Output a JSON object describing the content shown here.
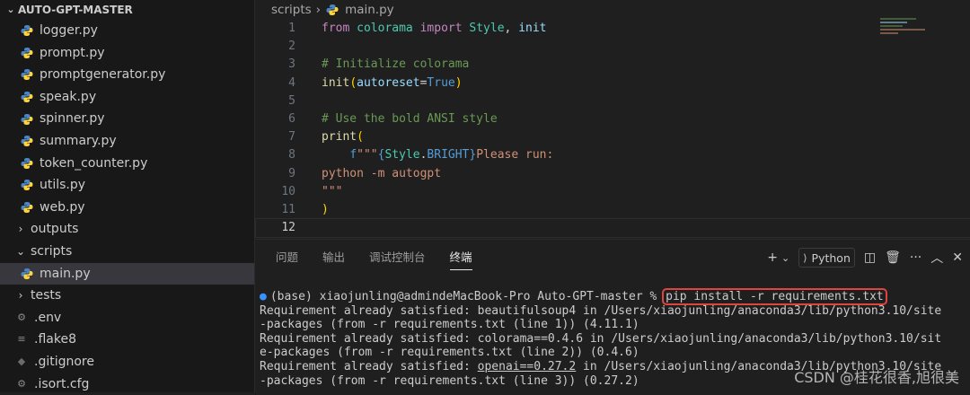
{
  "explorer": {
    "root_label": "AUTO-GPT-MASTER",
    "items": [
      {
        "label": "logger.py",
        "type": "py",
        "indent": 2
      },
      {
        "label": "prompt.py",
        "type": "py",
        "indent": 2
      },
      {
        "label": "promptgenerator.py",
        "type": "py",
        "indent": 2
      },
      {
        "label": "speak.py",
        "type": "py",
        "indent": 2
      },
      {
        "label": "spinner.py",
        "type": "py",
        "indent": 2
      },
      {
        "label": "summary.py",
        "type": "py",
        "indent": 2
      },
      {
        "label": "token_counter.py",
        "type": "py",
        "indent": 2
      },
      {
        "label": "utils.py",
        "type": "py",
        "indent": 2
      },
      {
        "label": "web.py",
        "type": "py",
        "indent": 2
      },
      {
        "label": "outputs",
        "type": "folder-closed",
        "indent": 1
      },
      {
        "label": "scripts",
        "type": "folder-open",
        "indent": 1
      },
      {
        "label": "main.py",
        "type": "py",
        "indent": 2,
        "selected": true
      },
      {
        "label": "tests",
        "type": "folder-closed",
        "indent": 1
      },
      {
        "label": ".env",
        "type": "gear",
        "indent": 1
      },
      {
        "label": ".flake8",
        "type": "lines",
        "indent": 1
      },
      {
        "label": ".gitignore",
        "type": "git",
        "indent": 1
      },
      {
        "label": ".isort.cfg",
        "type": "gear",
        "indent": 1
      }
    ]
  },
  "editor": {
    "breadcrumb": [
      "scripts",
      "main.py"
    ],
    "current_line": 12,
    "lines": [
      {
        "n": "1",
        "tokens": [
          [
            "kw",
            "from "
          ],
          [
            "mod",
            "colorama "
          ],
          [
            "kw",
            "import "
          ],
          [
            "mod",
            "Style"
          ],
          [
            "ltext",
            ", "
          ],
          [
            "id",
            "init"
          ]
        ]
      },
      {
        "n": "2",
        "tokens": []
      },
      {
        "n": "3",
        "tokens": [
          [
            "cm",
            "# Initialize colorama"
          ]
        ]
      },
      {
        "n": "4",
        "tokens": [
          [
            "fn",
            "init"
          ],
          [
            "br",
            "("
          ],
          [
            "id",
            "autoreset"
          ],
          [
            "ltext",
            "="
          ],
          [
            "cst",
            "True"
          ],
          [
            "br",
            ")"
          ]
        ]
      },
      {
        "n": "5",
        "tokens": []
      },
      {
        "n": "6",
        "tokens": [
          [
            "cm",
            "# Use the bold ANSI style"
          ]
        ]
      },
      {
        "n": "7",
        "tokens": [
          [
            "fn",
            "print"
          ],
          [
            "br",
            "("
          ]
        ]
      },
      {
        "n": "8",
        "tokens": [
          [
            "ltext",
            "    "
          ],
          [
            "cst",
            "f"
          ],
          [
            "str",
            "\"\"\""
          ],
          [
            "brace",
            "{"
          ],
          [
            "mod",
            "Style"
          ],
          [
            "ltext",
            "."
          ],
          [
            "cst",
            "BRIGHT"
          ],
          [
            "brace",
            "}"
          ],
          [
            "str",
            "Please run:"
          ]
        ]
      },
      {
        "n": "9",
        "tokens": [
          [
            "str",
            "python -m autogpt"
          ]
        ]
      },
      {
        "n": "10",
        "tokens": [
          [
            "str",
            "\"\"\""
          ]
        ]
      },
      {
        "n": "11",
        "tokens": [
          [
            "br",
            ")"
          ]
        ]
      },
      {
        "n": "12",
        "tokens": []
      }
    ]
  },
  "panel": {
    "tabs": [
      {
        "label": "问题",
        "active": false
      },
      {
        "label": "输出",
        "active": false
      },
      {
        "label": "调试控制台",
        "active": false
      },
      {
        "label": "终端",
        "active": true
      }
    ],
    "terminal_type": "Python",
    "prompt": "(base) xiaojunling@admindeMacBook-Pro Auto-GPT-master % ",
    "command": "pip install -r requirements.txt",
    "output": [
      "Requirement already satisfied: beautifulsoup4 in /Users/xiaojunling/anaconda3/lib/python3.10/site",
      "-packages (from -r requirements.txt (line 1)) (4.11.1)",
      "Requirement already satisfied: colorama==0.4.6 in /Users/xiaojunling/anaconda3/lib/python3.10/sit",
      "e-packages (from -r requirements.txt (line 2)) (0.4.6)"
    ],
    "output_req3_prefix": "Requirement already satisfied: ",
    "output_req3_pkg": "openai==0.27.2",
    "output_req3_rest": " in /Users/xiaojunling/anaconda3/lib/python3.10/site",
    "output_last": "-packages (from -r requirements.txt (line 3)) (0.27.2)"
  },
  "watermark": "CSDN @桂花很香,旭很美",
  "colors": {
    "accent": "#3794ff",
    "highlight_box": "#e0443e",
    "selected_row": "#37373d"
  }
}
